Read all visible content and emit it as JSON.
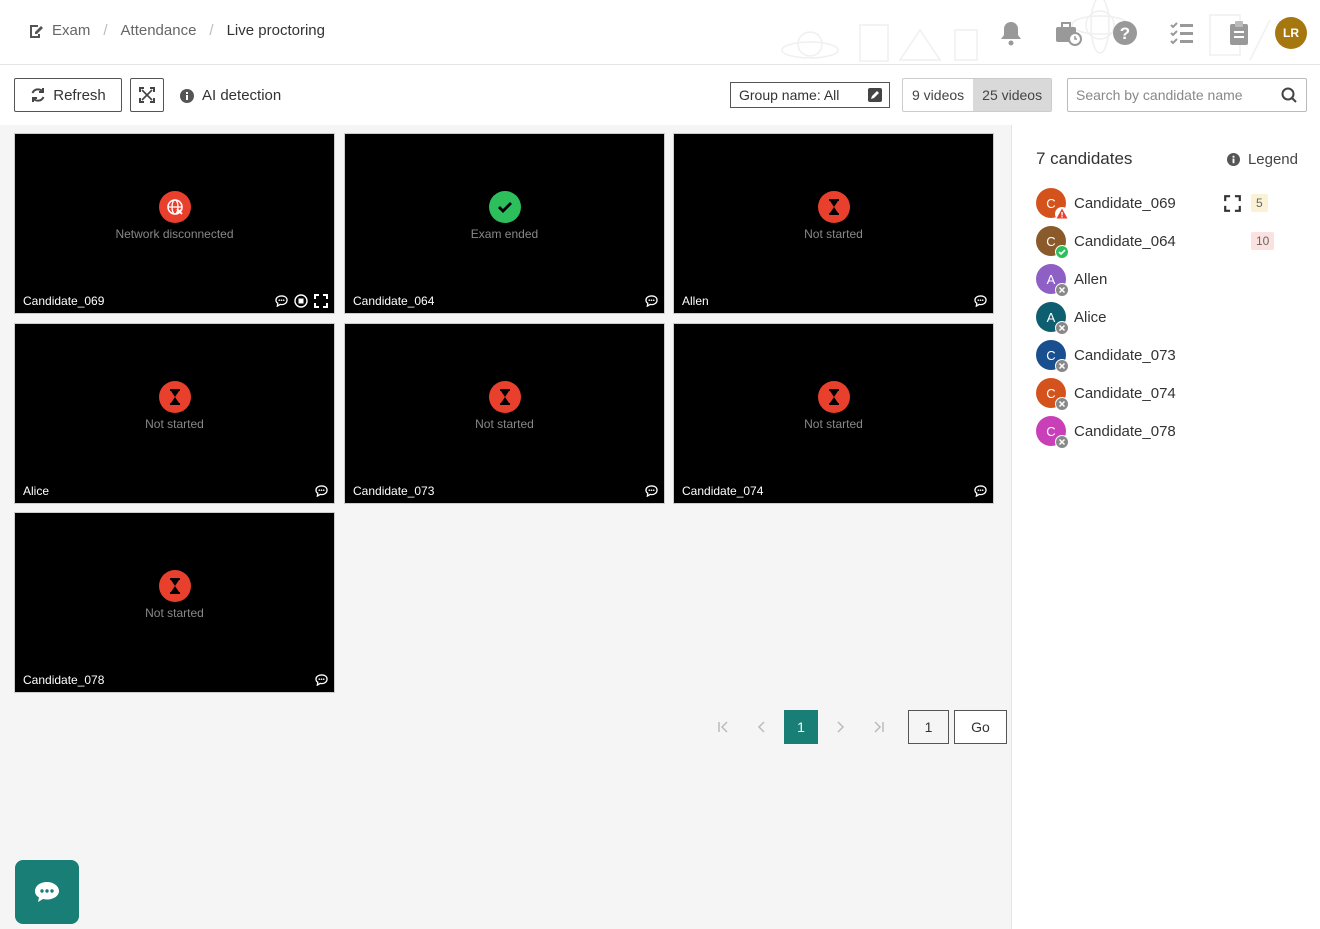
{
  "breadcrumb": {
    "items": [
      "Exam",
      "Attendance"
    ],
    "current": "Live proctoring"
  },
  "header": {
    "user_initials": "LR"
  },
  "toolbar": {
    "refresh_label": "Refresh",
    "ai_detection_label": "AI detection",
    "group_select": "Group name: All",
    "video_options": [
      "9 videos",
      "25 videos"
    ],
    "selected_video_option": "25 videos",
    "search_placeholder": "Search by candidate name"
  },
  "tiles": [
    {
      "name": "Candidate_069",
      "status": "Network disconnected",
      "status_color": "#e8402d",
      "icon": "network-disconnected-icon"
    },
    {
      "name": "Candidate_064",
      "status": "Exam ended",
      "status_color": "#2cbf5c",
      "icon": "check-icon"
    },
    {
      "name": "Allen",
      "status": "Not started",
      "status_color": "#e8402d",
      "icon": "hourglass-icon"
    },
    {
      "name": "Alice",
      "status": "Not started",
      "status_color": "#e8402d",
      "icon": "hourglass-icon"
    },
    {
      "name": "Candidate_073",
      "status": "Not started",
      "status_color": "#e8402d",
      "icon": "hourglass-icon"
    },
    {
      "name": "Candidate_074",
      "status": "Not started",
      "status_color": "#e8402d",
      "icon": "hourglass-icon"
    },
    {
      "name": "Candidate_078",
      "status": "Not started",
      "status_color": "#e8402d",
      "icon": "hourglass-icon"
    }
  ],
  "pagination": {
    "current_page": "1",
    "page_input": "1",
    "go_label": "Go"
  },
  "panel": {
    "title": "7 candidates",
    "legend_label": "Legend",
    "candidates": [
      {
        "initial": "C",
        "name": "Candidate_069",
        "color": "#d4531c",
        "badge": "warning",
        "count": "5",
        "count_style": "yellow",
        "expand": true
      },
      {
        "initial": "C",
        "name": "Candidate_064",
        "color": "#8a5a2b",
        "badge": "ok",
        "count": "10",
        "count_style": "red"
      },
      {
        "initial": "A",
        "name": "Allen",
        "color": "#8e5fc4",
        "badge": "off"
      },
      {
        "initial": "A",
        "name": "Alice",
        "color": "#0d5e6e",
        "badge": "off"
      },
      {
        "initial": "C",
        "name": "Candidate_073",
        "color": "#1a4f8f",
        "badge": "off"
      },
      {
        "initial": "C",
        "name": "Candidate_074",
        "color": "#d4531c",
        "badge": "off"
      },
      {
        "initial": "C",
        "name": "Candidate_078",
        "color": "#c83fb8",
        "badge": "off"
      }
    ]
  },
  "colors": {
    "accent": "#197f76",
    "danger": "#e8402d",
    "success": "#2cbf5c"
  }
}
